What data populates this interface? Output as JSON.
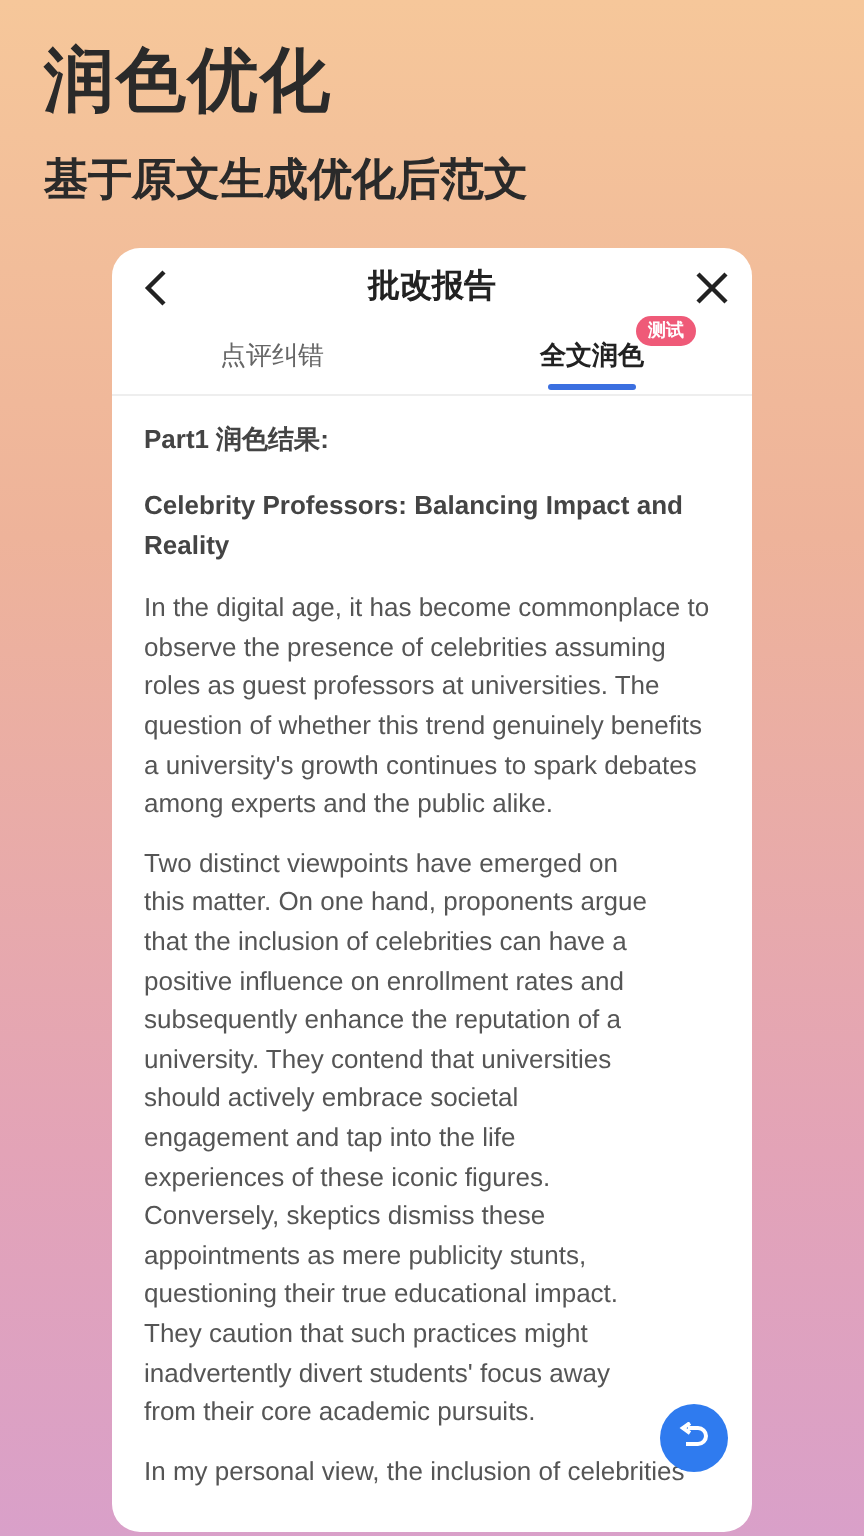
{
  "hero": {
    "title": "润色优化",
    "subtitle": "基于原文生成优化后范文"
  },
  "report": {
    "title": "批改报告",
    "tabs": [
      {
        "label": "点评纠错",
        "selected": false
      },
      {
        "label": "全文润色",
        "selected": true,
        "badge": "测试"
      }
    ],
    "section_heading": "Part1 润色结果:",
    "essay_title": "Celebrity Professors: Balancing Impact and Reality",
    "paragraphs": [
      "In the digital age, it has become commonplace to observe the presence of celebrities assuming roles as guest professors at universities. The question of whether this trend genuinely benefits a university's growth continues to spark debates among experts and the public alike.",
      "Two distinct viewpoints have emerged on this matter. On one hand, proponents argue that the inclusion of celebrities can have a positive influence on enrollment rates and subsequently enhance the reputation of a university. They contend that universities should actively embrace societal engagement and tap into the life experiences of these iconic figures. Conversely, skeptics dismiss these appointments as mere publicity stunts, questioning their true educational impact. They caution that such practices might inadvertently divert students' focus away from their core academic pursuits.",
      "In my personal view, the inclusion of celebrities"
    ]
  }
}
